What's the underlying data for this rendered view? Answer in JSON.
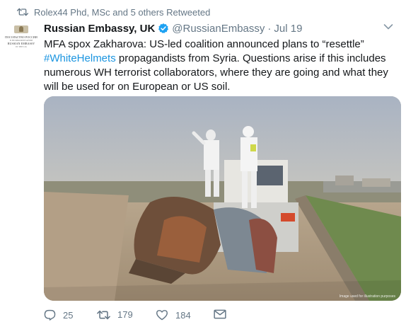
{
  "retweet_context": {
    "text": "Rolex44 Phd, MSc and 5 others Retweeted"
  },
  "avatar": {
    "line1": "ПОСОЛЬСТВО РОССИИ",
    "line2": "В ВЕЛИКОБРИТАНИИ",
    "line3": "RUSSIAN EMBASSY",
    "line4": "IN THE UK"
  },
  "tweet": {
    "author_name": "Russian Embassy, UK",
    "handle": "@RussianEmbassy",
    "separator": "·",
    "date": "Jul 19",
    "text_part1": "MFA spox Zakharova: US-led coalition announced plans to “resettle”",
    "hashtag": "#WhiteHelmets",
    "text_part2": " propagandists from Syria. Questions arise if this includes numerous WH terrorist collaborators, where they are going and what they will be used for on European or US soil.",
    "media_caption": "Image used for illustration purposes"
  },
  "actions": {
    "replies": "25",
    "retweets": "179",
    "likes": "184"
  },
  "colors": {
    "link": "#1b95e0",
    "muted": "#657786",
    "verified": "#1da1f2"
  }
}
